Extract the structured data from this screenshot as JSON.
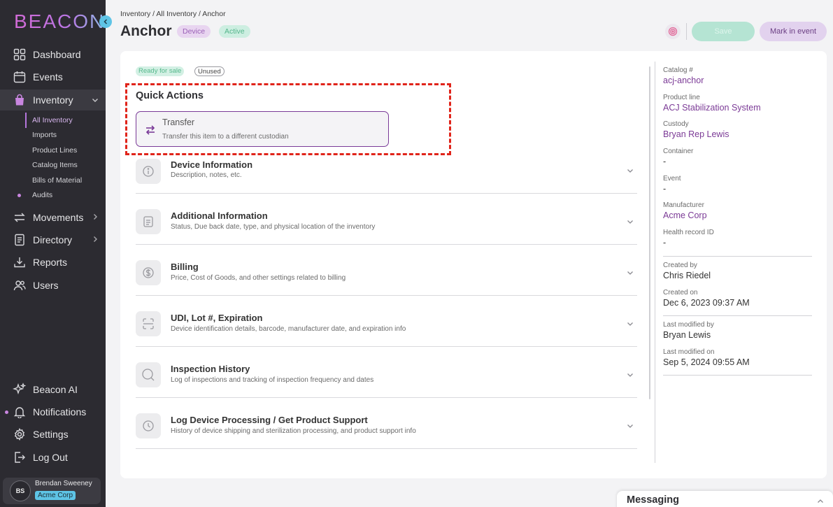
{
  "brand": {
    "logo_text": "BEACON",
    "accent": "#b575dc",
    "cyan": "#5ec4e6"
  },
  "sidebar": {
    "items": [
      {
        "label": "Dashboard",
        "icon": "grid-icon"
      },
      {
        "label": "Events",
        "icon": "calendar-icon"
      },
      {
        "label": "Inventory",
        "icon": "bag-icon"
      },
      {
        "label": "Movements",
        "icon": "arrows-icon"
      },
      {
        "label": "Directory",
        "icon": "book-icon"
      },
      {
        "label": "Reports",
        "icon": "download-icon"
      },
      {
        "label": "Users",
        "icon": "users-icon"
      }
    ],
    "inventory_sub": [
      "All Inventory",
      "Imports",
      "Product Lines",
      "Catalog Items",
      "Bills of Material",
      "Audits"
    ],
    "bottom": [
      {
        "label": "Beacon AI",
        "icon": "sparkle-icon"
      },
      {
        "label": "Notifications",
        "icon": "bell-icon"
      },
      {
        "label": "Settings",
        "icon": "gear-icon"
      },
      {
        "label": "Log Out",
        "icon": "logout-icon"
      }
    ],
    "user": {
      "initials": "BS",
      "name": "Brendan Sweeney",
      "org": "Acme Corp"
    }
  },
  "header": {
    "breadcrumb": "Inventory / All Inventory / Anchor",
    "title": "Anchor",
    "badge_device": "Device",
    "badge_active": "Active",
    "save_label": "Save",
    "mark_label": "Mark in event"
  },
  "main": {
    "tag_ready": "Ready for sale",
    "tag_unused": "Unused",
    "quick_actions_title": "Quick Actions",
    "transfer": {
      "title": "Transfer",
      "desc": "Transfer this item to a different custodian"
    },
    "sections": [
      {
        "title": "Device Information",
        "desc": "Description, notes, etc.",
        "icon": "info-icon"
      },
      {
        "title": "Additional Information",
        "desc": "Status, Due back date, type, and physical location of the inventory",
        "icon": "document-icon"
      },
      {
        "title": "Billing",
        "desc": "Price, Cost of Goods, and other settings related to billing",
        "icon": "dollar-icon"
      },
      {
        "title": "UDI, Lot #, Expiration",
        "desc": "Device identification details, barcode, manufacturer date, and expiration info",
        "icon": "scan-icon"
      },
      {
        "title": "Inspection History",
        "desc": "Log of inspections and tracking of inspection frequency and dates",
        "icon": "magnifier-icon"
      },
      {
        "title": "Log Device Processing / Get Product Support",
        "desc": "History of device shipping and sterilization processing, and product support info",
        "icon": "clock-icon"
      }
    ]
  },
  "details": {
    "catalog_label": "Catalog #",
    "catalog_value": "acj-anchor",
    "product_line_label": "Product line",
    "product_line_value": "ACJ Stabilization System",
    "custody_label": "Custody",
    "custody_value": "Bryan Rep Lewis",
    "container_label": "Container",
    "container_value": "-",
    "event_label": "Event",
    "event_value": "-",
    "manufacturer_label": "Manufacturer",
    "manufacturer_value": "Acme Corp",
    "health_label": "Health record ID",
    "health_value": "-",
    "created_by_label": "Created by",
    "created_by_value": "Chris Riedel",
    "created_on_label": "Created on",
    "created_on_value": "Dec 6, 2023 09:37 AM",
    "modified_by_label": "Last modified by",
    "modified_by_value": "Bryan Lewis",
    "modified_on_label": "Last modified on",
    "modified_on_value": "Sep 5, 2024 09:55 AM"
  },
  "messaging": {
    "title": "Messaging"
  }
}
